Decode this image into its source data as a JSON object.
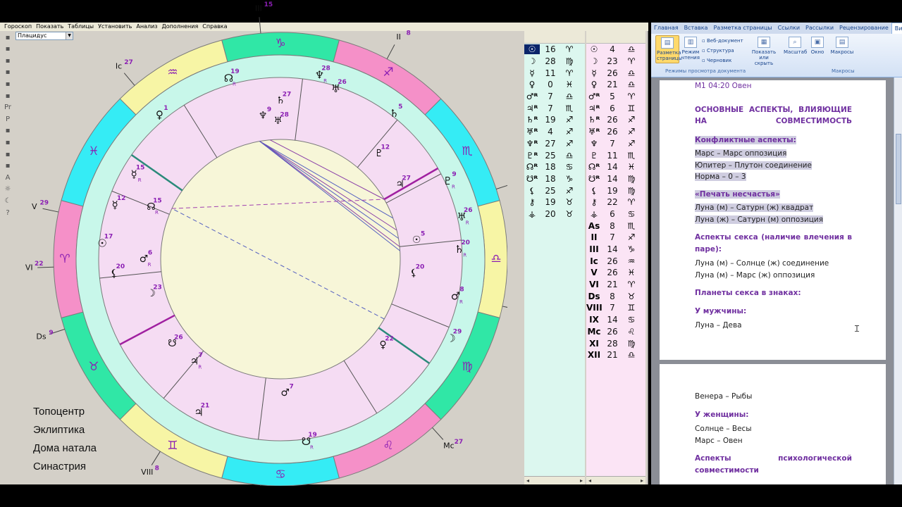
{
  "astro": {
    "menu": [
      "Гороскоп",
      "Показать",
      "Таблицы",
      "Установить",
      "Анализ",
      "Дополнения",
      "Справка"
    ],
    "house_system": "Плацидус",
    "toolbar_icons": [
      "new-chart-icon",
      "open-folder-icon",
      "save-icon",
      "print-icon",
      "copy-icon",
      "table-icon",
      "pr-icon",
      "p-icon",
      "list-icon",
      "sliders-icon",
      "aspect-icon",
      "stamp-icon",
      "a-icon",
      "sun-icon",
      "moon-icon",
      "help-icon"
    ],
    "toolbar_labels": [
      "",
      "",
      "",
      "",
      "",
      "",
      "Pr",
      "P",
      "",
      "",
      "",
      "",
      "A",
      "☼",
      "☾",
      "?"
    ],
    "options": [
      "Топоцентр",
      "Эклиптика",
      "Дома натала",
      "Синастрия"
    ],
    "zodiac": [
      {
        "glyph": "♑",
        "color": "#30e7a6"
      },
      {
        "glyph": "♐",
        "color": "#f590c8"
      },
      {
        "glyph": "♏",
        "color": "#35ecf5"
      },
      {
        "glyph": "♎",
        "color": "#f7f5a5"
      },
      {
        "glyph": "♍",
        "color": "#30e7a6"
      },
      {
        "glyph": "♌",
        "color": "#f590c8"
      },
      {
        "glyph": "♋",
        "color": "#35ecf5"
      },
      {
        "glyph": "♊",
        "color": "#f7f5a5"
      },
      {
        "glyph": "♉",
        "color": "#30e7a6"
      },
      {
        "glyph": "♈",
        "color": "#f590c8"
      },
      {
        "glyph": "♓",
        "color": "#35ecf5"
      },
      {
        "glyph": "♒",
        "color": "#f7f5a5"
      }
    ],
    "house_labels": [
      {
        "label": "III",
        "deg": "15"
      },
      {
        "label": "II",
        "deg": "8"
      },
      {
        "label": "As",
        "deg": "9"
      },
      {
        "label": "XII",
        "deg": "22"
      },
      {
        "label": "XI",
        "deg": "29"
      },
      {
        "label": "Mc",
        "deg": "27"
      },
      {
        "label": "IX",
        "deg": "15"
      },
      {
        "label": "VIII",
        "deg": "8"
      },
      {
        "label": "Ds",
        "deg": "9"
      },
      {
        "label": "VI",
        "deg": "22"
      },
      {
        "label": "V",
        "deg": "29"
      },
      {
        "label": "Ic",
        "deg": "27"
      }
    ],
    "outer_planets": [
      {
        "glyph": "♆",
        "deg": "28",
        "r": "R"
      },
      {
        "glyph": "♅",
        "deg": "26",
        "r": ""
      },
      {
        "glyph": "☊",
        "deg": "19",
        "r": "R"
      },
      {
        "glyph": "♄",
        "deg": "5",
        "r": ""
      },
      {
        "glyph": "♀",
        "deg": "1",
        "r": ""
      },
      {
        "glyph": "♇",
        "deg": "9",
        "r": "R"
      },
      {
        "glyph": "♅",
        "deg": "26",
        "r": "R"
      },
      {
        "glyph": "♄",
        "deg": "20",
        "r": "R"
      },
      {
        "glyph": "♂",
        "deg": "8",
        "r": "R"
      },
      {
        "glyph": "☽",
        "deg": "29",
        "r": ""
      },
      {
        "glyph": "☿",
        "deg": "12",
        "r": ""
      },
      {
        "glyph": "☉",
        "deg": "17",
        "r": ""
      },
      {
        "glyph": "☿",
        "deg": "15",
        "r": "R"
      },
      {
        "glyph": "⚸",
        "deg": "20",
        "r": ""
      },
      {
        "glyph": "♃",
        "deg": "21",
        "r": ""
      },
      {
        "glyph": "☋",
        "deg": "19",
        "r": "R"
      }
    ],
    "inner_planets": [
      {
        "glyph": "♆",
        "deg": "9",
        "r": ""
      },
      {
        "glyph": "♄",
        "deg": "27",
        "r": ""
      },
      {
        "glyph": "♅",
        "deg": "28",
        "r": ""
      },
      {
        "glyph": "♇",
        "deg": "12",
        "r": ""
      },
      {
        "glyph": "♃",
        "deg": "27",
        "r": ""
      },
      {
        "glyph": "☉",
        "deg": "5",
        "r": ""
      },
      {
        "glyph": "⚸",
        "deg": "20",
        "r": ""
      },
      {
        "glyph": "♀",
        "deg": "22",
        "r": ""
      },
      {
        "glyph": "♂",
        "deg": "7",
        "r": ""
      },
      {
        "glyph": "♃",
        "deg": "7",
        "r": "R"
      },
      {
        "glyph": "☋",
        "deg": "26",
        "r": ""
      },
      {
        "glyph": "☽",
        "deg": "23",
        "r": ""
      },
      {
        "glyph": "♂",
        "deg": "6",
        "r": "R"
      },
      {
        "glyph": "☊",
        "deg": "15",
        "r": "R"
      }
    ],
    "table1": [
      {
        "p": "☉",
        "d": "16",
        "z": "♈"
      },
      {
        "p": "☽",
        "d": "28",
        "z": "♍"
      },
      {
        "p": "☿",
        "d": "11",
        "z": "♈"
      },
      {
        "p": "♀",
        "d": "0",
        "z": "♓"
      },
      {
        "p": "♂ᴿ",
        "d": "7",
        "z": "♎"
      },
      {
        "p": "♃ᴿ",
        "d": "7",
        "z": "♏"
      },
      {
        "p": "♄ᴿ",
        "d": "19",
        "z": "♐"
      },
      {
        "p": "♅ᴿ",
        "d": "4",
        "z": "♐"
      },
      {
        "p": "♆ᴿ",
        "d": "27",
        "z": "♐"
      },
      {
        "p": "♇ᴿ",
        "d": "25",
        "z": "♎"
      },
      {
        "p": "☊ᴿ",
        "d": "18",
        "z": "♋"
      },
      {
        "p": "☋ᴿ",
        "d": "18",
        "z": "♑"
      },
      {
        "p": "⚸",
        "d": "25",
        "z": "♐"
      },
      {
        "p": "⚷",
        "d": "19",
        "z": "♉"
      },
      {
        "p": "⚶",
        "d": "20",
        "z": "♉"
      }
    ],
    "table2": [
      {
        "p": "☉",
        "d": "4",
        "z": "♎"
      },
      {
        "p": "☽",
        "d": "23",
        "z": "♈"
      },
      {
        "p": "☿",
        "d": "26",
        "z": "♎"
      },
      {
        "p": "♀",
        "d": "21",
        "z": "♎"
      },
      {
        "p": "♂ᴿ",
        "d": "5",
        "z": "♈"
      },
      {
        "p": "♃ᴿ",
        "d": "6",
        "z": "♊"
      },
      {
        "p": "♄ᴿ",
        "d": "26",
        "z": "♐"
      },
      {
        "p": "♅ᴿ",
        "d": "26",
        "z": "♐"
      },
      {
        "p": "♆",
        "d": "7",
        "z": "♐"
      },
      {
        "p": "♇",
        "d": "11",
        "z": "♏"
      },
      {
        "p": "☊ᴿ",
        "d": "14",
        "z": "♓"
      },
      {
        "p": "☋ᴿ",
        "d": "14",
        "z": "♍"
      },
      {
        "p": "⚸",
        "d": "19",
        "z": "♍"
      },
      {
        "p": "⚷",
        "d": "22",
        "z": "♈"
      },
      {
        "p": "⚶",
        "d": "6",
        "z": "♋"
      },
      {
        "p": "As",
        "d": "8",
        "z": "♏"
      },
      {
        "p": "II",
        "d": "7",
        "z": "♐"
      },
      {
        "p": "III",
        "d": "14",
        "z": "♑"
      },
      {
        "p": "Ic",
        "d": "26",
        "z": "♒"
      },
      {
        "p": "V",
        "d": "26",
        "z": "♓"
      },
      {
        "p": "VI",
        "d": "21",
        "z": "♈"
      },
      {
        "p": "Ds",
        "d": "8",
        "z": "♉"
      },
      {
        "p": "VIII",
        "d": "7",
        "z": "♊"
      },
      {
        "p": "IX",
        "d": "14",
        "z": "♋"
      },
      {
        "p": "Mc",
        "d": "26",
        "z": "♌"
      },
      {
        "p": "XI",
        "d": "28",
        "z": "♍"
      },
      {
        "p": "XII",
        "d": "21",
        "z": "♎"
      }
    ]
  },
  "word": {
    "tabs": [
      "Главная",
      "Вставка",
      "Разметка страницы",
      "Ссылки",
      "Рассылки",
      "Рецензирование",
      "Вид"
    ],
    "ribbon": {
      "layout_btn": "Разметка страницы",
      "read_btn": "Режим чтения",
      "web_doc": "Веб-документ",
      "structure": "Структура",
      "draft": "Черновик",
      "show_hide": "Показать или скрыть",
      "zoom": "Масштаб",
      "window": "Окно",
      "macros": "Макросы",
      "group_views": "Режимы просмотра документа",
      "group_macros": "Макросы"
    },
    "page1": {
      "m1": "М1 04:20 Овен",
      "main_h": "ОСНОВНЫЕ АСПЕКТЫ, ВЛИЯЮЩИЕ НА СОВМЕСТИМОСТЬ",
      "conflict_h": "Конфликтные аспекты:",
      "conflict_1": "Марс – Марс оппозиция",
      "conflict_2": "Юпитер – Плутон соединение",
      "conflict_3": "Норма – 0 – 3",
      "misfortune_h": "«Печать несчастья»",
      "misfortune_1": "Луна (м) – Сатурн (ж) квадрат",
      "misfortune_2": "Луна (ж) – Сатурн (м) оппозиция",
      "sex_h": "Аспекты секса (наличие влечения в паре):",
      "sex_1": "Луна (м) – Солнце (ж) соединение",
      "sex_2": "Луна (м) – Марс (ж) оппозиция",
      "signs_h": "Планеты секса в знаках:",
      "man_h": "У мужчины:",
      "man_1": "Луна – Дева"
    },
    "page2": {
      "man_2": "Венера – Рыбы",
      "woman_h": "У женщины:",
      "woman_1": "Солнце – Весы",
      "woman_2": "Марс – Овен",
      "psych_h": "Аспекты психологической совместимости"
    }
  }
}
